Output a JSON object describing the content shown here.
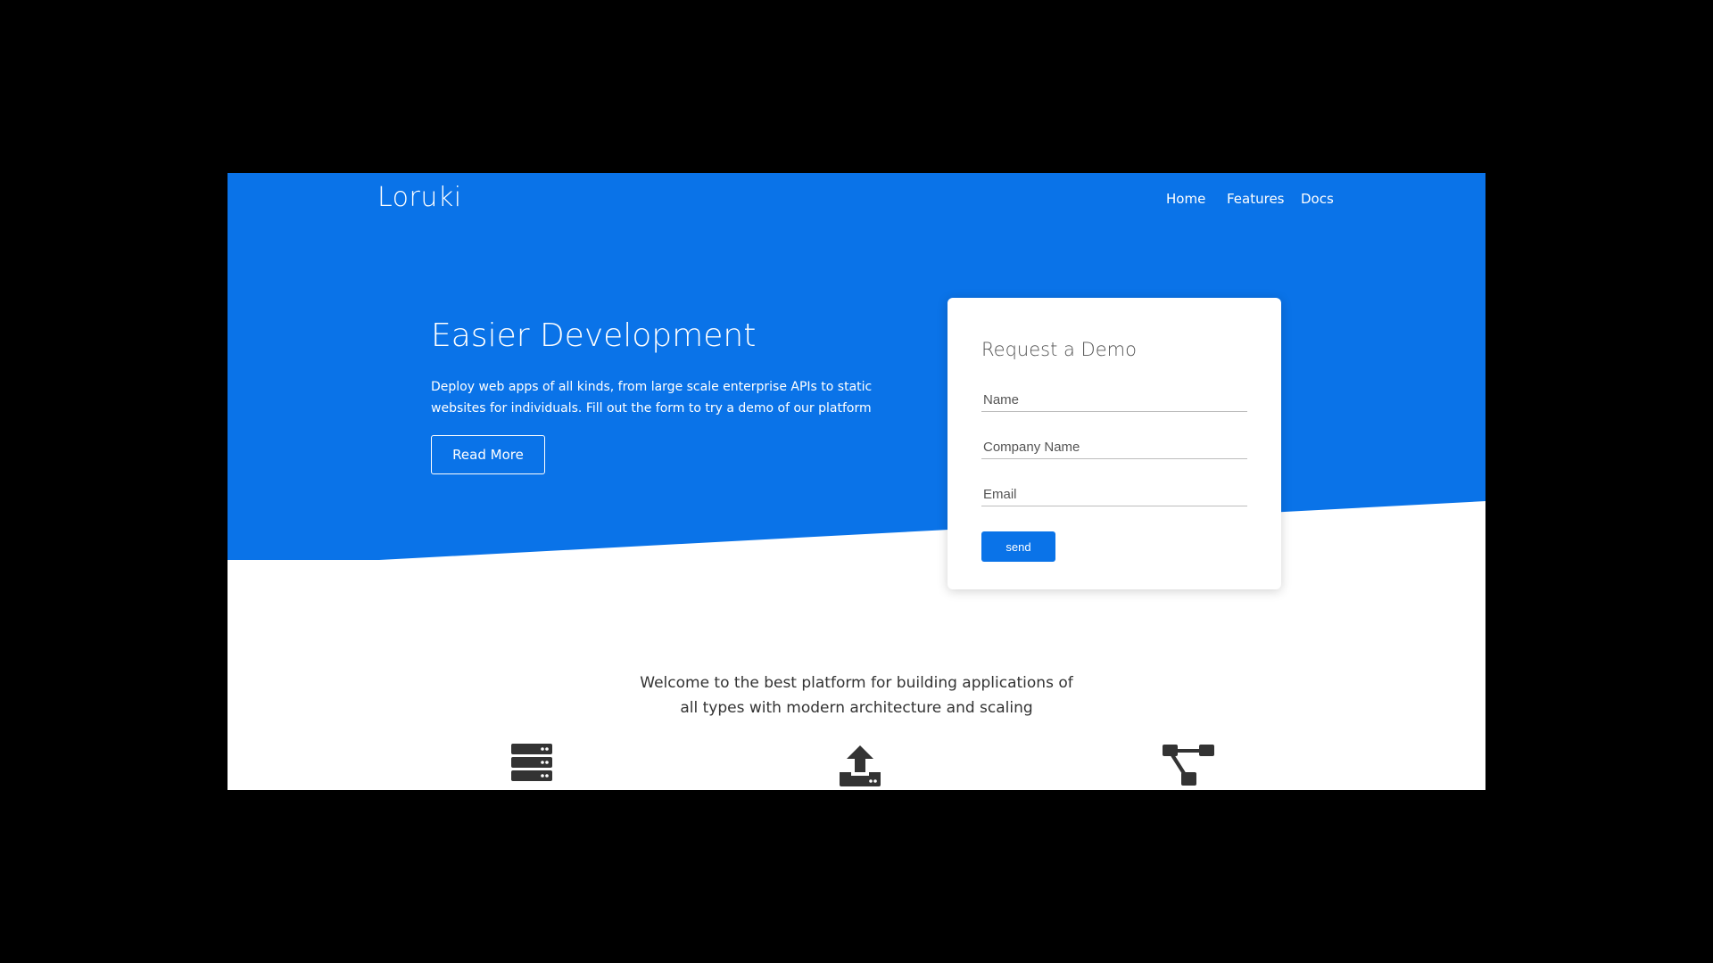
{
  "brand": {
    "name": "Loruki"
  },
  "nav": {
    "items": [
      "Home",
      "Features",
      "Docs"
    ]
  },
  "hero": {
    "title": "Easier Development",
    "text": "Deploy web apps of all kinds, from large scale enterprise APIs to static websites for individuals. Fill out the form to try a demo of our platform",
    "button_label": "Read More"
  },
  "demo_form": {
    "title": "Request a Demo",
    "name_placeholder": "Name",
    "company_placeholder": "Company Name",
    "email_placeholder": "Email",
    "submit_label": "send"
  },
  "welcome": {
    "text": "Welcome to the best platform for building applications of all types with modern architecture and scaling"
  },
  "features": {
    "icons": [
      "server-icon",
      "upload-icon",
      "network-icon"
    ]
  },
  "colors": {
    "primary": "#0a73e8",
    "backdrop": "#000000",
    "icon": "#333333"
  }
}
